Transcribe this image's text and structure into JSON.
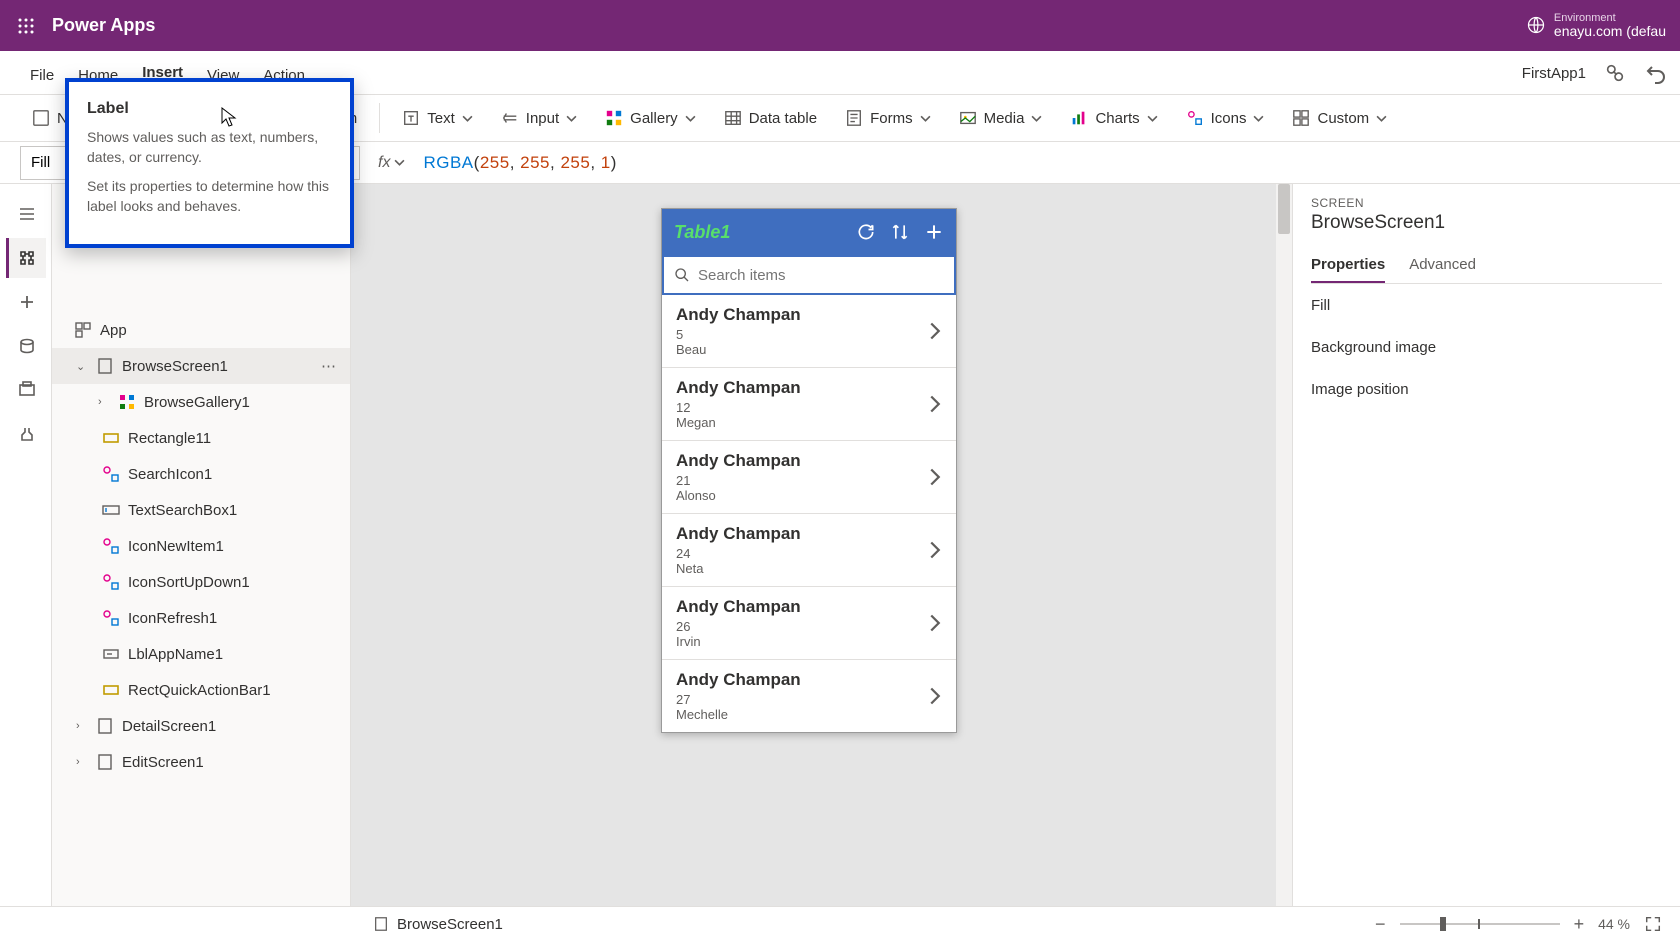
{
  "header": {
    "app_title": "Power Apps",
    "env_label": "Environment",
    "env_name": "enayu.com (defau"
  },
  "menu": {
    "items": [
      "File",
      "Home",
      "Insert",
      "View",
      "Action"
    ],
    "active": "Insert",
    "app_name": "FirstApp1"
  },
  "ribbon": {
    "new_screen": "New screen",
    "label": "Label",
    "button": "Button",
    "text": "Text",
    "input": "Input",
    "gallery": "Gallery",
    "data_table": "Data table",
    "forms": "Forms",
    "media": "Media",
    "charts": "Charts",
    "icons": "Icons",
    "custom": "Custom"
  },
  "formula": {
    "property": "Fill",
    "fn": "RGBA",
    "a0": "255",
    "a1": "255",
    "a2": "255",
    "a3": "1"
  },
  "tree": {
    "app": "App",
    "screens": [
      {
        "name": "BrowseScreen1",
        "expanded": true,
        "selected": true,
        "children": [
          {
            "name": "BrowseGallery1",
            "icon": "gallery",
            "exp": true
          },
          {
            "name": "Rectangle11",
            "icon": "rect"
          },
          {
            "name": "SearchIcon1",
            "icon": "iconctrl"
          },
          {
            "name": "TextSearchBox1",
            "icon": "textbox"
          },
          {
            "name": "IconNewItem1",
            "icon": "iconctrl"
          },
          {
            "name": "IconSortUpDown1",
            "icon": "iconctrl"
          },
          {
            "name": "IconRefresh1",
            "icon": "iconctrl"
          },
          {
            "name": "LblAppName1",
            "icon": "label"
          },
          {
            "name": "RectQuickActionBar1",
            "icon": "rect"
          }
        ]
      },
      {
        "name": "DetailScreen1",
        "expanded": false
      },
      {
        "name": "EditScreen1",
        "expanded": false
      }
    ]
  },
  "phone": {
    "title": "Table1",
    "search_placeholder": "Search items",
    "items": [
      {
        "title": "Andy Champan",
        "sub1": "5",
        "sub2": "Beau"
      },
      {
        "title": "Andy Champan",
        "sub1": "12",
        "sub2": "Megan"
      },
      {
        "title": "Andy Champan",
        "sub1": "21",
        "sub2": "Alonso"
      },
      {
        "title": "Andy Champan",
        "sub1": "24",
        "sub2": "Neta"
      },
      {
        "title": "Andy Champan",
        "sub1": "26",
        "sub2": "Irvin"
      },
      {
        "title": "Andy Champan",
        "sub1": "27",
        "sub2": "Mechelle"
      }
    ]
  },
  "props": {
    "section": "SCREEN",
    "name": "BrowseScreen1",
    "tabs": {
      "properties": "Properties",
      "advanced": "Advanced"
    },
    "rows": [
      "Fill",
      "Background image",
      "Image position"
    ]
  },
  "status": {
    "screen": "BrowseScreen1",
    "zoom": "44  %"
  },
  "tooltip": {
    "title": "Label",
    "p1": "Shows values such as text, numbers, dates, or currency.",
    "p2": "Set its properties to determine how this label looks and behaves."
  }
}
